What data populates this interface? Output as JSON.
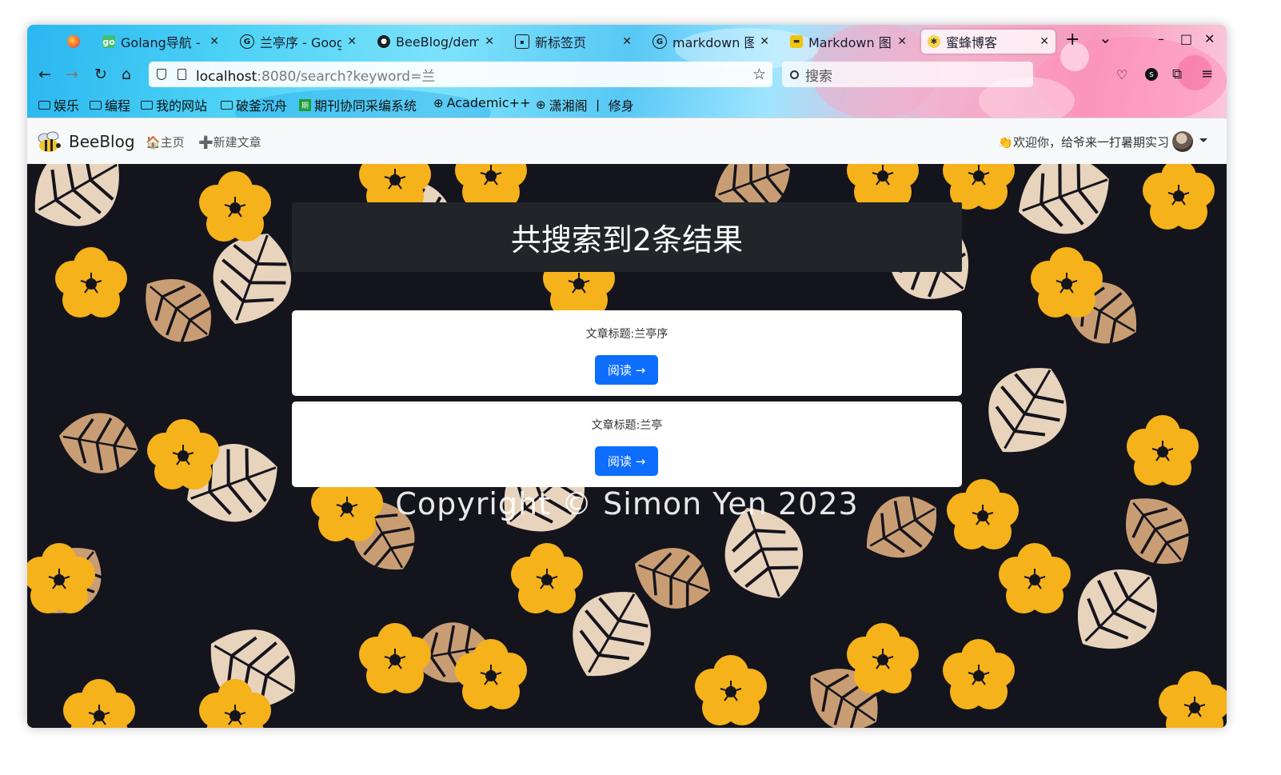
{
  "browser": {
    "tabs": [
      {
        "label": "Golang导航 - 编",
        "favicon": "golang-favicon",
        "active": false
      },
      {
        "label": "兰亭序 - Google",
        "favicon": "google-favicon",
        "active": false
      },
      {
        "label": "BeeBlog/demo",
        "favicon": "github-favicon",
        "active": false
      },
      {
        "label": "新标签页",
        "favicon": "newtab-favicon",
        "active": false
      },
      {
        "label": "markdown 图片",
        "favicon": "google-favicon",
        "active": false
      },
      {
        "label": "Markdown 图片",
        "favicon": "markdown-favicon",
        "active": false
      },
      {
        "label": "蜜蜂博客",
        "favicon": "bee-favicon",
        "active": true
      }
    ],
    "new_tab": "+",
    "tab_list": "⌄",
    "window_controls": {
      "minimize": "–",
      "maximize": "□",
      "close": "✕"
    },
    "url": {
      "host": "localhost",
      "rest": ":8080/search?keyword=兰"
    },
    "search_placeholder": "搜索",
    "bookmarks": [
      {
        "label": "娱乐",
        "icon": "folder-icon"
      },
      {
        "label": "编程",
        "icon": "folder-icon"
      },
      {
        "label": "我的网站",
        "icon": "folder-icon"
      },
      {
        "label": "破釜沉舟",
        "icon": "folder-icon"
      },
      {
        "label": "期刊协同采编系统",
        "icon": "journal-icon"
      },
      {
        "label": "Academic++",
        "icon": "globe-icon"
      },
      {
        "label": "潇湘阁 丨 修身",
        "icon": "globe-icon"
      }
    ]
  },
  "site": {
    "brand": "BeeBlog",
    "nav": {
      "home": "🏠主页",
      "new_post": "➕新建文章"
    },
    "welcome": "👏欢迎你，给爷来一打暑期实习"
  },
  "search": {
    "summary": "共搜索到2条结果",
    "results": [
      {
        "title": "文章标题:兰亭序",
        "button": "阅读 →"
      },
      {
        "title": "文章标题:兰亭",
        "button": "阅读 →"
      }
    ]
  },
  "footer": {
    "copyright": "Copyright © Simon Yen 2023"
  },
  "colors": {
    "primary_button": "#0d6efd",
    "header_bg": "#212529",
    "flower": "#f5b21a",
    "leaf_light": "#e8d3bd",
    "leaf_tan": "#c99d74",
    "background_dark": "#14141c"
  }
}
